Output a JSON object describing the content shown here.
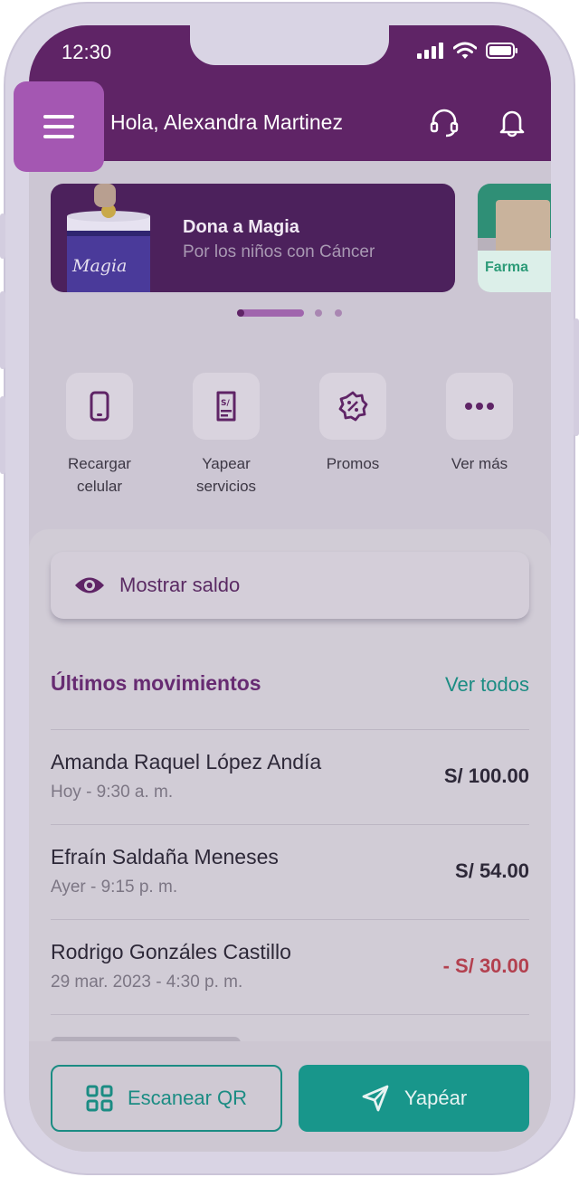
{
  "status_bar": {
    "time": "12:30"
  },
  "header": {
    "greeting": "Hola, Alexandra Martinez"
  },
  "banners": [
    {
      "title": "Dona a Magia",
      "subtitle": "Por los niños con Cáncer",
      "brand": "Magia"
    },
    {
      "brand": "Farma"
    }
  ],
  "shortcuts": [
    {
      "line1": "Recargar",
      "line2": "celular",
      "icon": "phone-icon"
    },
    {
      "line1": "Yapear",
      "line2": "servicios",
      "icon": "bill-icon"
    },
    {
      "line1": "Promos",
      "line2": "",
      "icon": "discount-icon"
    },
    {
      "line1": "Ver más",
      "line2": "",
      "icon": "more-icon"
    }
  ],
  "balance": {
    "label": "Mostrar saldo"
  },
  "movements": {
    "title": "Últimos movimientos",
    "see_all": "Ver todos",
    "items": [
      {
        "name": "Amanda Raquel López Andía",
        "date": "Hoy - 9:30 a. m.",
        "amount": "S/ 100.00"
      },
      {
        "name": "Efraín Saldaña Meneses",
        "date": "Ayer - 9:15 p. m.",
        "amount": "S/ 54.00"
      },
      {
        "name": "Rodrigo Gonzáles Castillo",
        "date": "29  mar.  2023 - 4:30 p. m.",
        "amount": "- S/ 30.00"
      }
    ]
  },
  "actions": {
    "scan_label": "Escanear QR",
    "yape_label": "Yapéar"
  },
  "colors": {
    "header": "#5f2466",
    "accent": "#18968b",
    "negative_amount": "#b3404f",
    "menu_button": "#a457b2"
  }
}
